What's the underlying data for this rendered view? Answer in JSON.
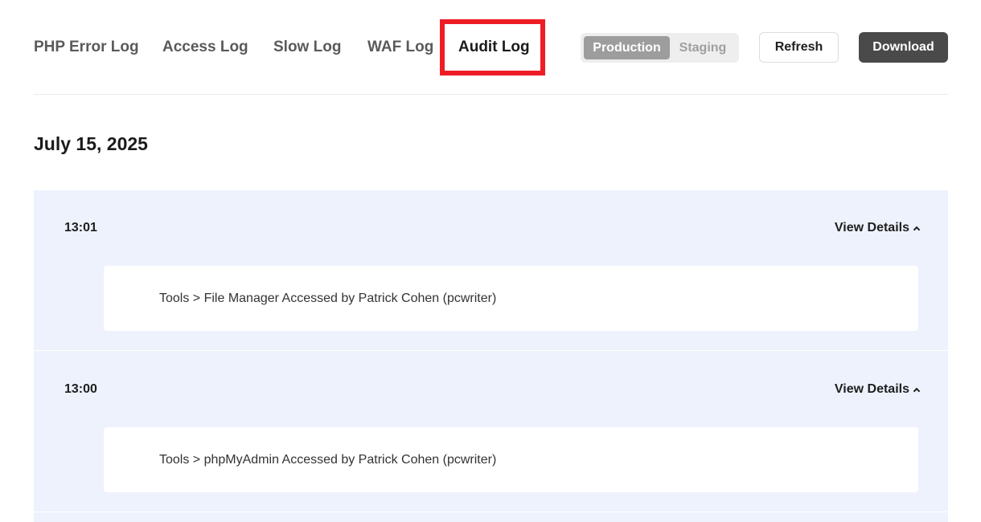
{
  "tabs": {
    "php_error": "PHP Error Log",
    "access": "Access Log",
    "slow": "Slow Log",
    "waf": "WAF Log",
    "audit": "Audit Log"
  },
  "environment": {
    "production": "Production",
    "staging": "Staging",
    "selected": "Production"
  },
  "actions": {
    "refresh": "Refresh",
    "download": "Download"
  },
  "date": "July 15, 2025",
  "entries": [
    {
      "time": "13:01",
      "toggle": "View Details",
      "message": "Tools > File Manager Accessed by Patrick Cohen (pcwriter)"
    },
    {
      "time": "13:00",
      "toggle": "View Details",
      "message": "Tools > phpMyAdmin Accessed by Patrick Cohen (pcwriter)"
    }
  ],
  "colors": {
    "highlight": "#ee1c25",
    "list_bg": "#eef2fd",
    "download_bg": "#4a4a4a"
  }
}
